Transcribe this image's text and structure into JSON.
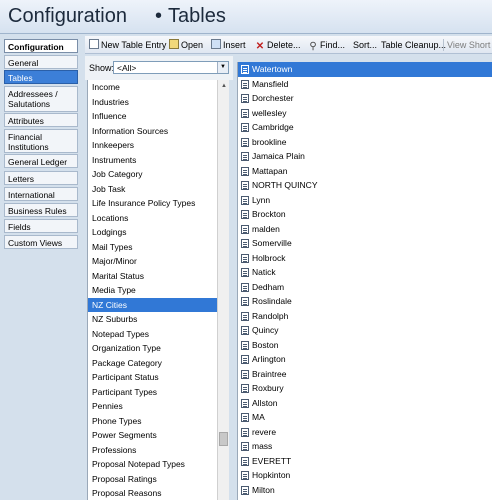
{
  "header": {
    "title": "Configuration",
    "bullet": "•",
    "section": "Tables"
  },
  "nav": {
    "items": [
      {
        "label": "Configuration"
      },
      {
        "label": "General"
      },
      {
        "label": "Tables"
      },
      {
        "label": "Addressees / Salutations"
      },
      {
        "label": "Attributes"
      },
      {
        "label": "Financial Institutions"
      },
      {
        "label": "General Ledger"
      },
      {
        "label": "Letters"
      },
      {
        "label": "International"
      },
      {
        "label": "Business Rules"
      },
      {
        "label": "Fields"
      },
      {
        "label": "Custom Views"
      }
    ]
  },
  "toolbar": {
    "new_label": "New Table Entry",
    "open_label": "Open",
    "insert_label": "Insert",
    "delete_label": "Delete...",
    "find_label": "Find...",
    "sort_label": "Sort...",
    "cleanup_label": "Table Cleanup...",
    "view_short_label": "View Short D"
  },
  "show": {
    "label": "Show:",
    "value": "<All>"
  },
  "tables_list": [
    "Income",
    "Industries",
    "Influence",
    "Information Sources",
    "Innkeepers",
    "Instruments",
    "Job Category",
    "Job Task",
    "Life Insurance Policy Types",
    "Locations",
    "Lodgings",
    "Mail Types",
    "Major/Minor",
    "Marital Status",
    "Media Type",
    "NZ Cities",
    "NZ Suburbs",
    "Notepad Types",
    "Organization Type",
    "Package Category",
    "Participant Status",
    "Participant Types",
    "Pennies",
    "Phone Types",
    "Power Segments",
    "Professions",
    "Proposal Notepad Types",
    "Proposal Ratings",
    "Proposal Reasons"
  ],
  "tables_selected": "NZ Cities",
  "entries": [
    "Watertown",
    "Mansfield",
    "Dorchester",
    "wellesley",
    "Cambridge",
    "brookline",
    "Jamaica Plain",
    "Mattapan",
    "NORTH QUINCY",
    "Lynn",
    "Brockton",
    "malden",
    "Somerville",
    "Holbrock",
    "Natick",
    "Dedham",
    "Roslindale",
    "Randolph",
    "Quincy",
    "Boston",
    "Arlington",
    "Braintree",
    "Roxbury",
    "Allston",
    "MA",
    "revere",
    "mass",
    "EVERETT",
    "Hopkinton",
    "Milton"
  ],
  "entries_selected": "Watertown"
}
